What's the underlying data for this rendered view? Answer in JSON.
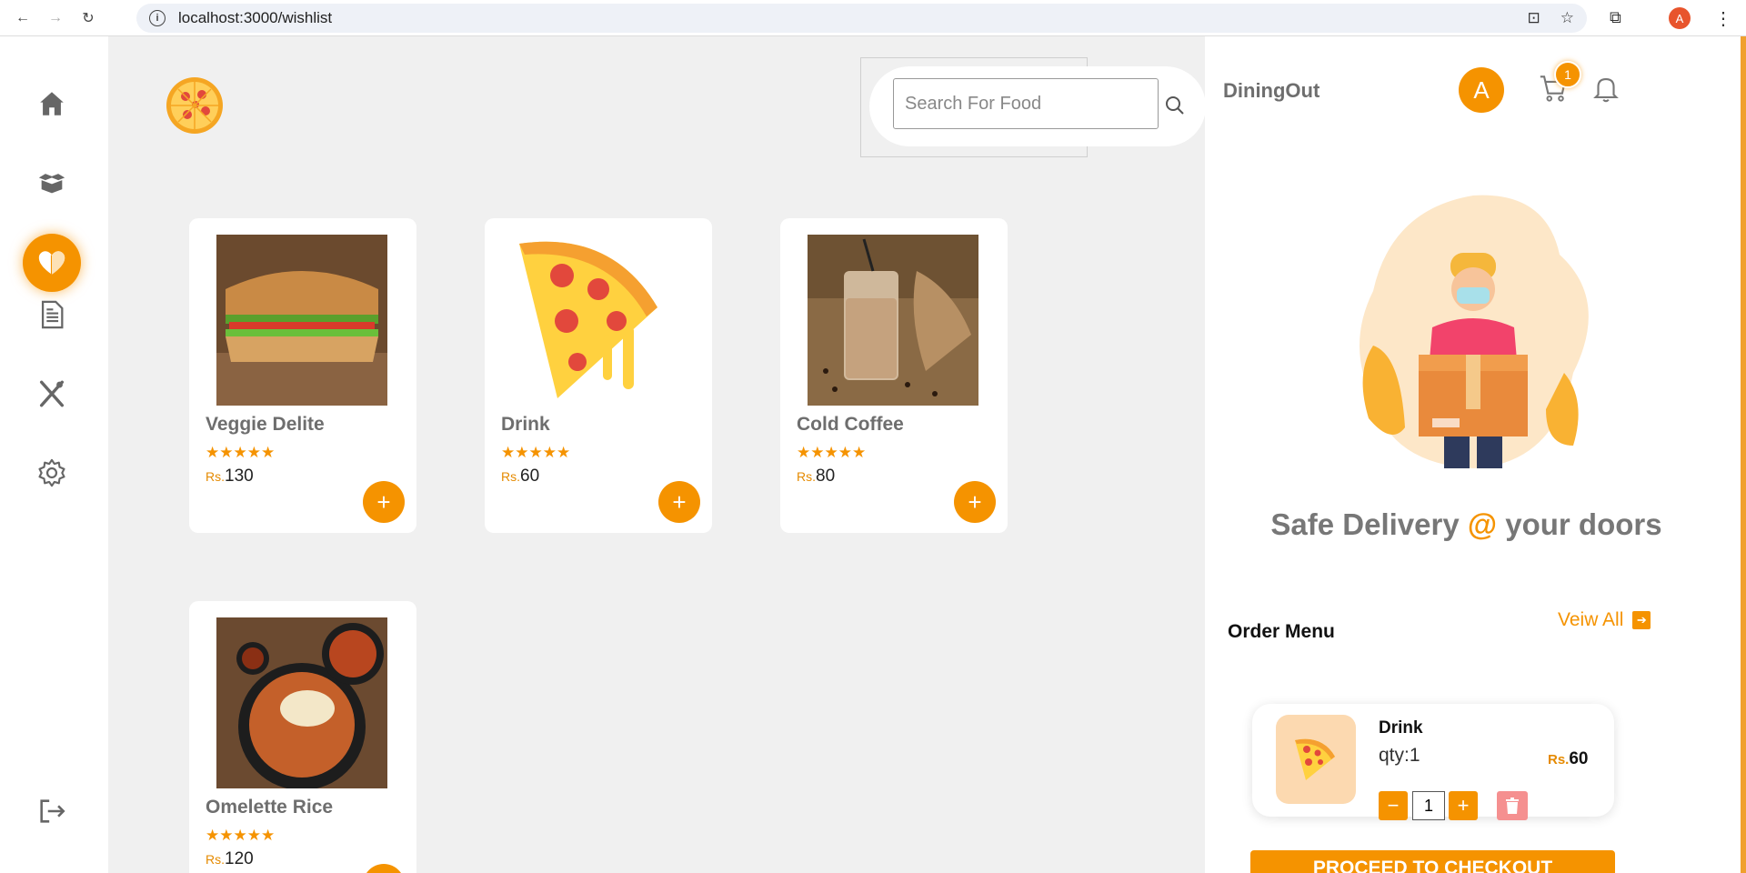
{
  "browser": {
    "url": "localhost:3000/wishlist",
    "profile_initial": "A"
  },
  "sidebar": {
    "items": [
      {
        "name": "home"
      },
      {
        "name": "orders"
      },
      {
        "name": "wishlist",
        "active": true
      },
      {
        "name": "bills"
      },
      {
        "name": "menu"
      },
      {
        "name": "settings"
      }
    ],
    "logout": "logout"
  },
  "search": {
    "placeholder": "Search For Food"
  },
  "products": [
    {
      "name": "Veggie Delite",
      "currency": "Rs.",
      "price": "130",
      "rating": "★★★★★",
      "add_label": "+"
    },
    {
      "name": "Drink",
      "currency": "Rs.",
      "price": "60",
      "rating": "★★★★★",
      "add_label": "+"
    },
    {
      "name": "Cold Coffee",
      "currency": "Rs.",
      "price": "80",
      "rating": "★★★★★",
      "add_label": "+"
    },
    {
      "name": "Omelette Rice",
      "currency": "Rs.",
      "price": "120",
      "rating": "★★★★★",
      "add_label": "+"
    }
  ],
  "right_panel": {
    "brand": "DiningOut",
    "avatar_initial": "A",
    "cart_count": "1",
    "tagline_pre": "Safe Delivery ",
    "tagline_at": "@",
    "tagline_post": " your doors",
    "order_title": "Order Menu",
    "view_all": "Veiw All",
    "view_all_arrow": "➔",
    "order_item": {
      "name": "Drink",
      "qty_label": "qty:1",
      "currency": "Rs.",
      "price": "60",
      "qty_value": "1",
      "minus": "−",
      "plus": "+"
    },
    "checkout_label": "PROCEED TO CHECKOUT"
  },
  "colors": {
    "accent": "#f59300",
    "background": "#f0f0f0"
  }
}
